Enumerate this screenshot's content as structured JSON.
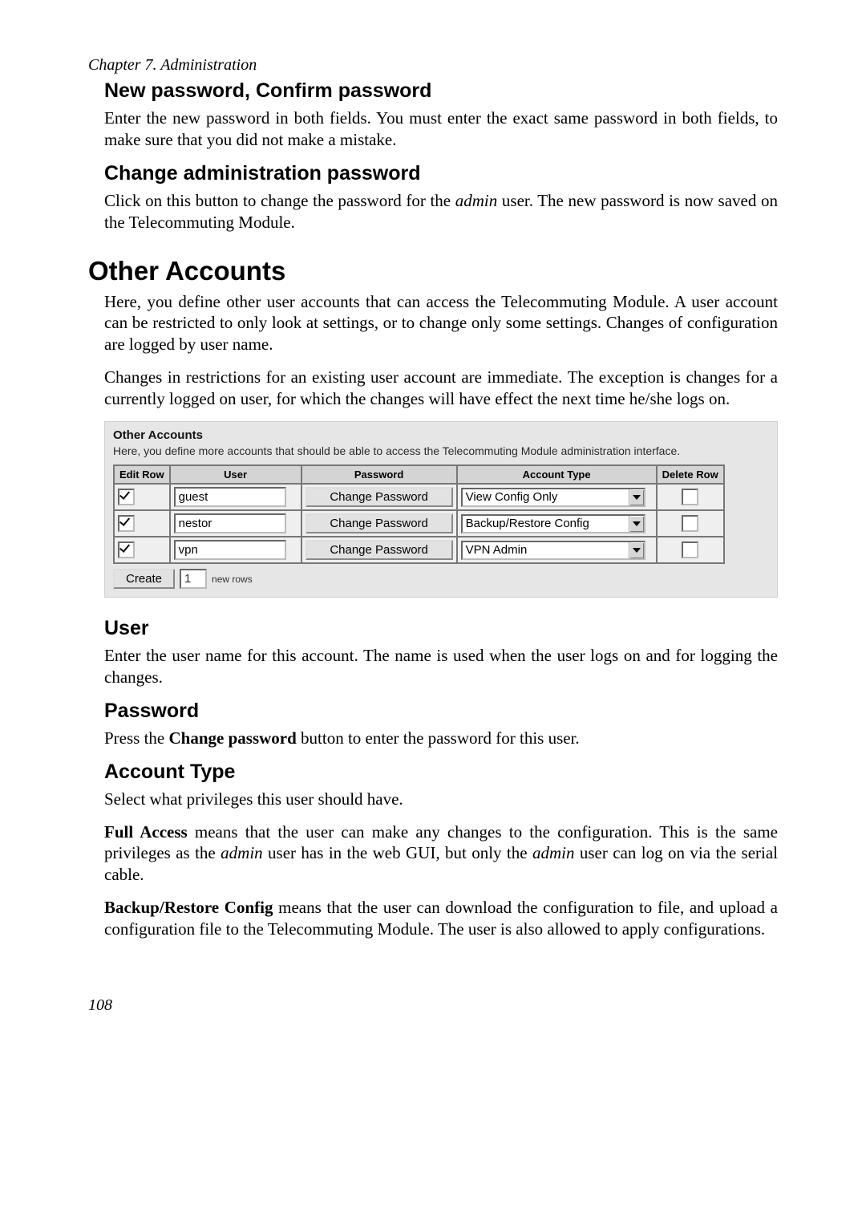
{
  "chapter_header": "Chapter 7. Administration",
  "section_newpw": {
    "title": "New password, Confirm password",
    "body": "Enter the new password in both fields. You must enter the exact same password in both fields, to make sure that you did not make a mistake."
  },
  "section_changepw": {
    "title": "Change administration password",
    "body_pre": "Click on this button to change the password for the ",
    "body_em": "admin",
    "body_post": " user. The new password is now saved on the Telecommuting Module."
  },
  "section_other": {
    "title": "Other Accounts",
    "p1": "Here, you define other user accounts that can access the Telecommuting Module. A user account can be restricted to only look at settings, or to change only some settings. Changes of configuration are logged by user name.",
    "p2": "Changes in restrictions for an existing user account are immediate. The exception is changes for a currently logged on user, for which the changes will have effect the next time he/she logs on."
  },
  "panel": {
    "title": "Other Accounts",
    "desc": "Here, you define more accounts that should be able to access the Telecommuting Module administration interface.",
    "headers": {
      "c1": "Edit Row",
      "c2": "User",
      "c3": "Password",
      "c4": "Account Type",
      "c5": "Delete Row"
    },
    "rows": [
      {
        "user": "guest",
        "pw_btn": "Change Password",
        "type": "View Config Only"
      },
      {
        "user": "nestor",
        "pw_btn": "Change Password",
        "type": "Backup/Restore Config"
      },
      {
        "user": "vpn",
        "pw_btn": "Change Password",
        "type": "VPN Admin"
      }
    ],
    "create_btn": "Create",
    "create_qty": "1",
    "create_suffix": "new rows"
  },
  "section_user": {
    "title": "User",
    "body": "Enter the user name for this account. The name is used when the user logs on and for logging the changes."
  },
  "section_password": {
    "title": "Password",
    "body_pre": "Press the ",
    "body_bold": "Change password",
    "body_post": " button to enter the password for this user."
  },
  "section_accttype": {
    "title": "Account Type",
    "p1": "Select what privileges this user should have.",
    "p2_b": "Full Access",
    "p2_pre": " means that the user can make any changes to the configuration. This is the same privileges as the ",
    "p2_em1": "admin",
    "p2_mid": " user has in the web GUI, but only the ",
    "p2_em2": "admin",
    "p2_post": " user can log on via the serial cable.",
    "p3_b": "Backup/Restore Config",
    "p3": " means that the user can download the configuration to file, and upload a configuration file to the Telecommuting Module. The user is also allowed to apply configurations."
  },
  "pagenum": "108"
}
